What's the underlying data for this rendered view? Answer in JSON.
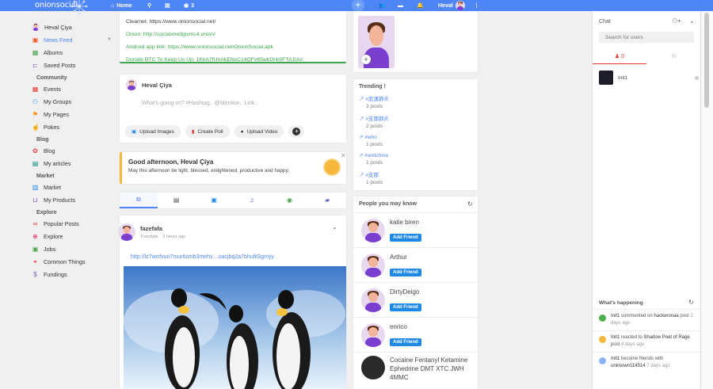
{
  "topbar": {
    "logo": "onionsocial",
    "home": "Home",
    "notif_count": "3",
    "username": "Heval"
  },
  "sidebar": {
    "user": "Heval Çiya",
    "items": [
      {
        "label": "News Feed"
      },
      {
        "label": "Albums"
      },
      {
        "label": "Saved Posts"
      }
    ],
    "community_head": "Community",
    "community": [
      {
        "label": "Events"
      },
      {
        "label": "My Groups"
      },
      {
        "label": "My Pages"
      },
      {
        "label": "Pokes"
      }
    ],
    "blog_head": "Blog",
    "blog": [
      {
        "label": "Blog"
      },
      {
        "label": "My articles"
      }
    ],
    "market_head": "Market",
    "market": [
      {
        "label": "Market"
      },
      {
        "label": "My Products"
      }
    ],
    "explore_head": "Explore",
    "explore": [
      {
        "label": "Popular Posts"
      },
      {
        "label": "Explore"
      },
      {
        "label": "Jobs"
      },
      {
        "label": "Common Things"
      },
      {
        "label": "Fundings"
      }
    ]
  },
  "info": {
    "clearnet": "Clearnet: https://www.onionsocial.net/",
    "onion": "Onion: http://socialxnedgivmc4.onion/",
    "android": "Android app link: https://www.onionsocial.net/OnionSocial.apk",
    "donate": "Donate BTC To Keep Us Up: 1KkA7fUnAkENxC14QFv65wkDnk9FTA1tAs"
  },
  "composer": {
    "name": "Heval Çiya",
    "placeholder": "What's going on? #Hashtag.. @Mention.. Link..",
    "upload_images": "Upload Images",
    "create_poll": "Create Poll",
    "upload_video": "Upload Video"
  },
  "greeting": {
    "title": "Good afternoon, Heval Çiya",
    "text": "May this afternoon be light, blessed, enlightened, productive and happy."
  },
  "post": {
    "author": "fazefafa",
    "translate": "Translate",
    "time": "2 hours ago",
    "link": "http://lz7wrrfvun7mur6smb3mehv....oacjbq2a7bhufit3gmyy"
  },
  "trending": {
    "title": "Trending !",
    "items": [
      {
        "tag": "#武漢肺炎",
        "count": "3 posts"
      },
      {
        "tag": "#支那肺炎",
        "count": "2 posts"
      },
      {
        "tag": "#who",
        "count": "1 posts"
      },
      {
        "tag": "#anitchina",
        "count": "1 posts"
      },
      {
        "tag": "#支那",
        "count": "1 posts"
      }
    ]
  },
  "pymk": {
    "title": "People you may know",
    "add": "Add Friend",
    "people": [
      {
        "name": "katie biren"
      },
      {
        "name": "Arthur"
      },
      {
        "name": "DirtyDeigo"
      },
      {
        "name": "enrico"
      },
      {
        "name": "Cocaine Fentanyl Ketamine Ephedrine DMT XTC JWH 4MMC"
      }
    ]
  },
  "chat": {
    "title": "Chat",
    "search_placeholder": "Search for users",
    "online_count": "0",
    "user": "Init1"
  },
  "happening": {
    "title": "What's happening",
    "items": [
      {
        "user": "Init1",
        "action": "commented on",
        "target": "hackeronaa",
        "text": " post",
        "time": "2 days ago",
        "color": "#4caf50"
      },
      {
        "user": "Init1",
        "action": "reacted to",
        "target": "Shadow Poet of Rage",
        "text": " post",
        "time": "4 days ago",
        "color": "#f6b73c"
      },
      {
        "user": "Init1",
        "action": "become friends with",
        "target": "unknown114514",
        "text": "",
        "time": "7 days ago",
        "color": "#8ab4f8"
      }
    ]
  },
  "colors": {
    "accent": "#4f86f7",
    "green": "#3ca84a",
    "button": "#1e88e5"
  }
}
